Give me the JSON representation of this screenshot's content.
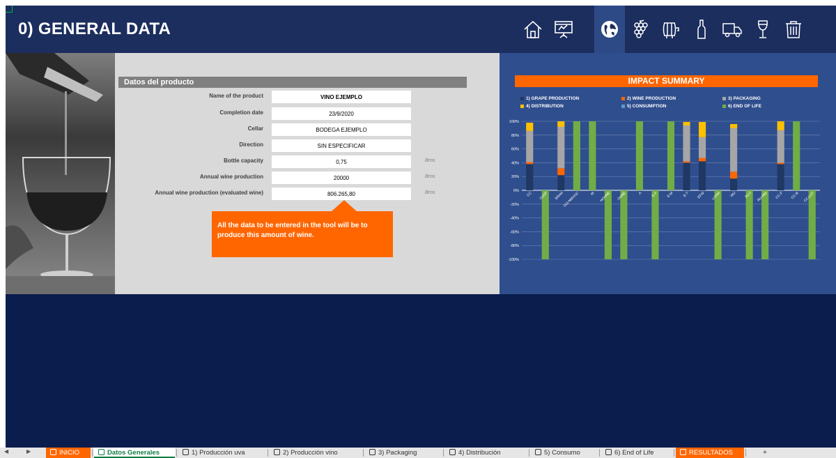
{
  "header": {
    "title": "0) GENERAL DATA",
    "nav_icons": [
      "home-icon",
      "presentation-icon",
      "globe-icon",
      "grape-icon",
      "barrel-icon",
      "bottle-icon",
      "truck-icon",
      "wine-glass-icon",
      "trash-icon"
    ],
    "active_icon": "globe-icon"
  },
  "form": {
    "section_title": "Datos del producto",
    "rows": [
      {
        "label": "Name of the product",
        "value": "VINO EJEMPLO",
        "unit": ""
      },
      {
        "label": "Completion date",
        "value": "23/9/2020",
        "unit": ""
      },
      {
        "label": "Cellar",
        "value": "BODEGA EJEMPLO",
        "unit": ""
      },
      {
        "label": "Direction",
        "value": "SIN ESPECIFICAR",
        "unit": ""
      },
      {
        "label": "Bottle capacity",
        "value": "0,75",
        "unit": "litros"
      },
      {
        "label": "Annual wine production",
        "value": "20000",
        "unit": "litros"
      },
      {
        "label": "Annual  wine production (evaluated wine)",
        "value": "806.265,80",
        "unit": "litros"
      }
    ]
  },
  "callout": {
    "text": "All the data to be entered in the tool will be to produce this amount of wine."
  },
  "chart_data": {
    "type": "bar",
    "stacked": true,
    "title": "IMPACT SUMMARY",
    "categories": [
      "CC",
      "OzDP",
      "SRHH",
      "DIZ-NMVOC",
      "RI",
      "HOHNE",
      "OHNE",
      "A",
      "E-F",
      "E-M",
      "E-T",
      "EFW",
      "LUAM",
      "WU",
      "RU-f",
      "RU-MM",
      "CC-F",
      "CC-B",
      "CC-LUT"
    ],
    "series": [
      {
        "name": "1) GRAPE PRODUCTION",
        "color": "#1f3864",
        "values": [
          38,
          0,
          22,
          0,
          0,
          0,
          0,
          0,
          0,
          0,
          40,
          42,
          0,
          17,
          0,
          0,
          38,
          0,
          0
        ]
      },
      {
        "name": "2) WINE PRODUCTION",
        "color": "#ff6600",
        "values": [
          3,
          0,
          10,
          0,
          0,
          0,
          0,
          0,
          0,
          0,
          2,
          5,
          0,
          10,
          0,
          0,
          2,
          0,
          0
        ]
      },
      {
        "name": "3) PACKAGING",
        "color": "#a6a6a6",
        "values": [
          45,
          0,
          60,
          0,
          0,
          0,
          0,
          0,
          0,
          0,
          52,
          30,
          0,
          63,
          0,
          0,
          47,
          0,
          0
        ]
      },
      {
        "name": "4) DISTRIBUTION",
        "color": "#ffc000",
        "values": [
          12,
          0,
          8,
          0,
          0,
          0,
          0,
          0,
          0,
          0,
          5,
          22,
          0,
          6,
          0,
          0,
          13,
          0,
          0
        ]
      },
      {
        "name": "5) CONSUMPTION",
        "color": "#5b9bd5",
        "values": [
          0,
          0,
          0,
          0,
          0,
          0,
          0,
          0,
          0,
          0,
          0,
          0,
          0,
          0,
          0,
          0,
          0,
          0,
          0
        ]
      },
      {
        "name": "6) END OF LIFE",
        "color": "#70ad47",
        "values": [
          0,
          -100,
          0,
          100,
          100,
          -100,
          -100,
          100,
          -100,
          100,
          0,
          0,
          -100,
          0,
          -100,
          -100,
          0,
          100,
          -100
        ]
      }
    ],
    "ylim": [
      -100,
      100
    ],
    "yticks": [
      "100%",
      "80%",
      "60%",
      "40%",
      "20%",
      "0%",
      "-20%",
      "-40%",
      "-60%",
      "-80%",
      "-100%"
    ],
    "grid": true,
    "legend_position": "top"
  },
  "tabs": {
    "items": [
      {
        "label": "INICIO",
        "style": "orange"
      },
      {
        "label": "Datos Generales",
        "style": "active"
      },
      {
        "label": "1) Producción uva",
        "style": "normal"
      },
      {
        "label": "2) Producción vino",
        "style": "normal"
      },
      {
        "label": "3) Packaging",
        "style": "normal"
      },
      {
        "label": "4) Distribución",
        "style": "normal"
      },
      {
        "label": "5) Consumo",
        "style": "normal"
      },
      {
        "label": "6) End of Life",
        "style": "normal"
      },
      {
        "label": "RESULTADOS",
        "style": "orange"
      }
    ],
    "add_label": "+"
  }
}
